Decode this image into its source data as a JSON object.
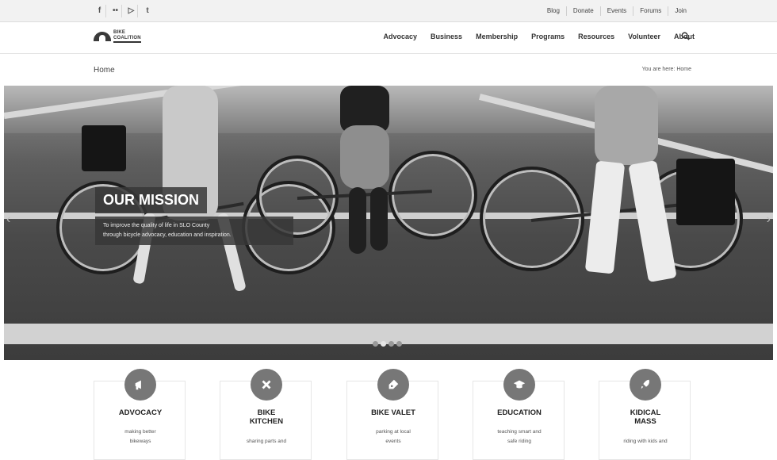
{
  "social": [
    {
      "icon": "facebook-icon",
      "glyph": "f"
    },
    {
      "icon": "flickr-icon",
      "glyph": "••"
    },
    {
      "icon": "youtube-icon",
      "glyph": "▷"
    },
    {
      "icon": "twitter-icon",
      "glyph": "t"
    }
  ],
  "top_links": [
    "Blog",
    "Donate",
    "Events",
    "Forums",
    "Join"
  ],
  "nav": {
    "items": [
      "Advocacy",
      "Business",
      "Membership",
      "Programs",
      "Resources",
      "Volunteer",
      "About"
    ]
  },
  "page": {
    "title": "Home",
    "breadcrumb": "You are here: Home"
  },
  "hero": {
    "title": "OUR MISSION",
    "text_line1": "To improve the quality of life in SLO County",
    "text_line2": "through bicycle advocacy, education and inspiration.",
    "slides": 4,
    "active_slide": 1
  },
  "cards": [
    {
      "title": "ADVOCACY",
      "desc1": "making better",
      "desc2": "bikeways",
      "icon": "megaphone-icon"
    },
    {
      "title": "BIKE KITCHEN",
      "title_l1": "BIKE",
      "title_l2": "KITCHEN",
      "desc1": "sharing parts and",
      "desc2": "",
      "icon": "wrench-icon"
    },
    {
      "title": "BIKE VALET",
      "desc1": "parking at local",
      "desc2": "events",
      "icon": "tag-icon"
    },
    {
      "title": "EDUCATION",
      "desc1": "teaching smart and",
      "desc2": "safe riding",
      "icon": "graduation-cap-icon"
    },
    {
      "title": "KIDICAL MASS",
      "title_l1": "KIDICAL",
      "title_l2": "MASS",
      "desc1": "riding with kids and",
      "desc2": "",
      "icon": "rocket-icon"
    }
  ]
}
